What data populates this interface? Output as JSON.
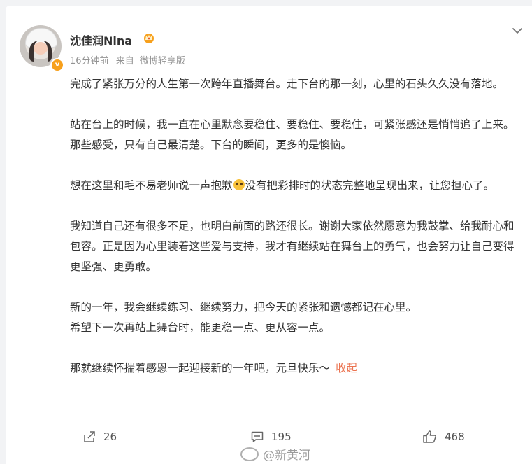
{
  "post": {
    "author": {
      "name": "沈佳润Nina",
      "avatar_badge": "v",
      "badge_icon": "crown-icon"
    },
    "meta": {
      "time": "16分钟前",
      "source_prefix": "来自",
      "source": "微博轻享版"
    },
    "paragraphs": {
      "p1": "完成了紧张万分的人生第一次跨年直播舞台。走下台的那一刻，心里的石头久久没有落地。",
      "p2": "站在台上的时候，我一直在心里默念要稳住、要稳住、要稳住，可紧张感还是悄悄追了上来。那些感受，只有自己最清楚。下台的瞬间，更多的是懊恼。",
      "p3a": "想在这里和毛不易老师说一声抱歉",
      "p3b": "没有把彩排时的状态完整地呈现出来，让您担心了。",
      "p4": "我知道自己还有很多不足，也明白前面的路还很长。谢谢大家依然愿意为我鼓掌、给我耐心和包容。正是因为心里装着这些爱与支持，我才有继续站在舞台上的勇气，也会努力让自己变得更坚强、更勇敢。",
      "p5": "新的一年，我会继续练习、继续努力，把今天的紧张和遗憾都记在心里。",
      "p6": "希望下一次再站上舞台时，能更稳一点、更从容一点。",
      "p7": "那就继续怀揣着感恩一起迎接新的一年吧，元旦快乐～"
    },
    "collapse_label": "收起",
    "actions": {
      "share_count": "26",
      "comment_count": "195",
      "like_count": "468"
    },
    "watermark": "@新黄河"
  }
}
